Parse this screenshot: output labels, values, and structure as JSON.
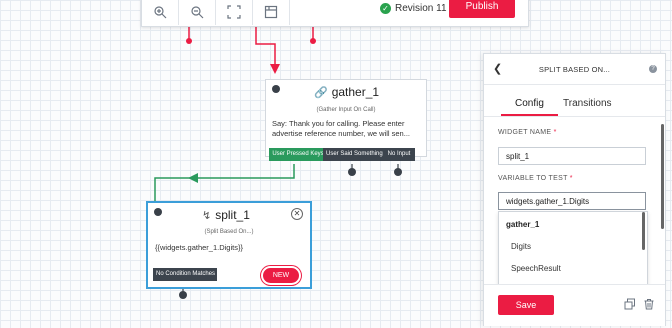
{
  "toolbar": {
    "buttons": [
      "zoom-in-icon",
      "zoom-out-icon",
      "fit-screen-icon",
      "layout-icon"
    ],
    "revision_label": "Revision 11",
    "publish_label": "Publish"
  },
  "gather_widget": {
    "title": "gather_1",
    "subtitle": "(Gather Input On Call)",
    "body": "Say: Thank you for calling. Please enter advertise reference number, we will sen...",
    "transitions": [
      "User Pressed Keys",
      "User Said Something",
      "No Input"
    ]
  },
  "split_widget": {
    "title": "split_1",
    "subtitle": "(Split Based On...)",
    "body": "{{widgets.gather_1.Digits}}",
    "transition": "No Condition Matches",
    "badge": "NEW",
    "close_glyph": "✕"
  },
  "panel": {
    "back_glyph": "❮",
    "title": "SPLIT BASED ON...",
    "help_glyph": "?",
    "tabs": [
      "Config",
      "Transitions"
    ],
    "active_tab": "Config",
    "widget_name_label": "WIDGET NAME",
    "widget_name_value": "split_1",
    "variable_label": "VARIABLE TO TEST",
    "variable_value": "widgets.gather_1.Digits",
    "required_mark": "*",
    "dropdown": {
      "group": "gather_1",
      "options": [
        "Digits",
        "SpeechResult"
      ]
    },
    "save_label": "Save"
  },
  "colors": {
    "accent": "#eb1c43",
    "success": "#2aa24e",
    "wire_green": "#2a9a5d",
    "selected_border": "#3b9ed9"
  }
}
